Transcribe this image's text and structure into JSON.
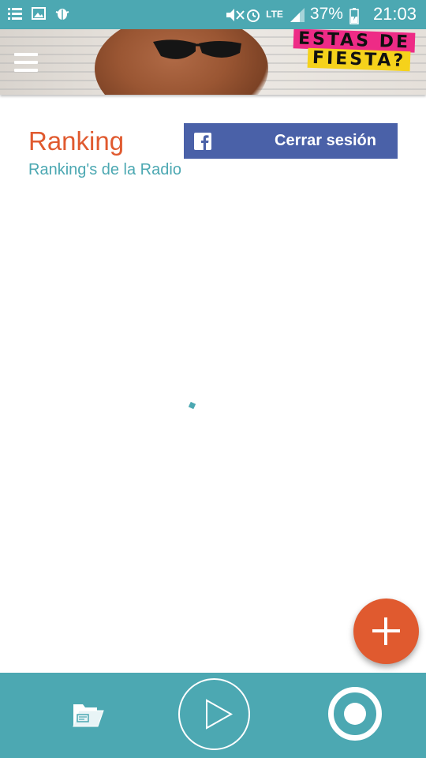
{
  "status_bar": {
    "battery_percent": "37%",
    "time": "21:03",
    "network_label": "LTE",
    "icons": [
      "list-icon",
      "image-icon",
      "bug-icon",
      "mute-icon",
      "alarm-icon",
      "signal-icon",
      "battery-icon"
    ]
  },
  "banner": {
    "line1": "ESTAS DE",
    "line2": "FIESTA?"
  },
  "header": {
    "title": "Ranking",
    "subtitle": "Ranking's de la Radio"
  },
  "facebook": {
    "logout_label": "Cerrar sesión"
  },
  "colors": {
    "teal": "#4ca8b2",
    "orange": "#e05a2f",
    "facebook_blue": "#4a61a8"
  }
}
